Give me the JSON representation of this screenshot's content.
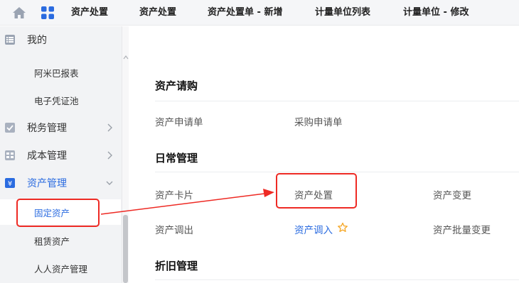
{
  "topbar": {
    "home_icon": "home-icon",
    "apps_icon": "grid-icon",
    "tabs": [
      {
        "label": "资产处置"
      },
      {
        "label": "资产处置"
      },
      {
        "label": "资产处置单 - 新增"
      },
      {
        "label": "计量单位列表"
      },
      {
        "label": "计量单位 - 修改"
      }
    ]
  },
  "sidebar": {
    "items": [
      {
        "label": "我的",
        "icon": "list-icon"
      },
      {
        "label": "阿米巴报表"
      },
      {
        "label": "电子凭证池"
      },
      {
        "label": "税务管理",
        "icon": "tax-icon"
      },
      {
        "label": "成本管理",
        "icon": "cost-icon"
      },
      {
        "label": "资产管理",
        "icon": "asset-icon"
      },
      {
        "label": "固定资产"
      },
      {
        "label": "租赁资产"
      },
      {
        "label": "人人资产管理"
      }
    ]
  },
  "main": {
    "sections": [
      {
        "title": "资产请购",
        "links": [
          "资产申请单",
          "采购申请单"
        ]
      },
      {
        "title": "日常管理",
        "links": [
          "资产卡片",
          "资产处置",
          "资产变更",
          "资产调出",
          "资产调入",
          "资产批量变更"
        ]
      },
      {
        "title": "折旧管理"
      }
    ]
  },
  "colors": {
    "accent": "#2a6be0",
    "annotation": "#ee2a24",
    "star": "#f5a623"
  }
}
